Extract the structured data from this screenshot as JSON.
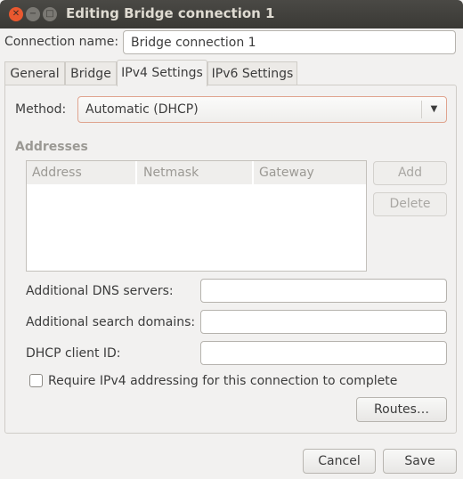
{
  "window": {
    "title": "Editing Bridge connection 1"
  },
  "connection_name": {
    "label": "Connection name:",
    "value": "Bridge connection 1"
  },
  "tabs": [
    {
      "label": "General"
    },
    {
      "label": "Bridge"
    },
    {
      "label": "IPv4 Settings",
      "active": true
    },
    {
      "label": "IPv6 Settings"
    }
  ],
  "ipv4": {
    "method_label": "Method:",
    "method_value": "Automatic (DHCP)",
    "addresses_heading": "Addresses",
    "columns": [
      "Address",
      "Netmask",
      "Gateway"
    ],
    "add_label": "Add",
    "delete_label": "Delete",
    "dns_label": "Additional DNS servers:",
    "dns_value": "",
    "search_label": "Additional search domains:",
    "search_value": "",
    "dhcp_label": "DHCP client ID:",
    "dhcp_value": "",
    "require_label": "Require IPv4 addressing for this connection to complete",
    "require_checked": false,
    "routes_label": "Routes…"
  },
  "footer": {
    "cancel_label": "Cancel",
    "save_label": "Save"
  },
  "colors": {
    "close": "#e9582f",
    "accent_border": "#e0a48f"
  }
}
